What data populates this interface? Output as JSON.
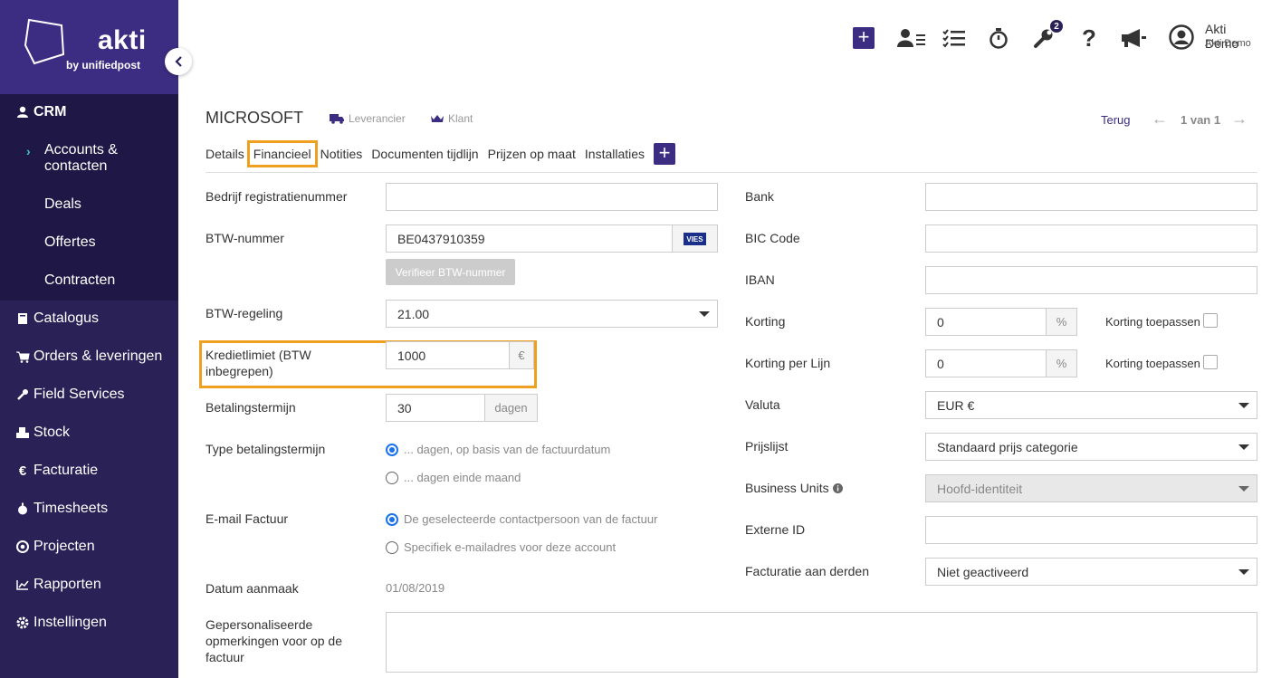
{
  "brand": {
    "name": "akti",
    "sub": "by unifiedpost"
  },
  "sidebar": {
    "crm": "CRM",
    "crm_items": [
      "Accounts &",
      "contacten",
      "Deals",
      "Offertes",
      "Contracten"
    ],
    "items": [
      "Catalogus",
      "Orders & leveringen",
      "Field Services",
      "Stock",
      "Facturatie",
      "Timesheets",
      "Projecten",
      "Rapporten",
      "Instellingen"
    ]
  },
  "topbar": {
    "badge_count": "2",
    "user_name": "Akti Demo",
    "user_company": "Akti Demo"
  },
  "header": {
    "company": "MICROSOFT",
    "tag_supplier": "Leverancier",
    "tag_client": "Klant",
    "back": "Terug",
    "pager": "1 van 1"
  },
  "tabs": [
    "Details",
    "Financieel",
    "Notities",
    "Documenten tijdlijn",
    "Prijzen op maat",
    "Installaties"
  ],
  "form_left": {
    "reg_label": "Bedrijf registratienummer",
    "btw_label": "BTW-nummer",
    "btw_value": "BE0437910359",
    "vies": "VIES",
    "verify_button": "Verifieer BTW-nummer",
    "regime_label": "BTW-regeling",
    "regime_value": "21.00",
    "credit_label_1": "Kredietlimiet (BTW",
    "credit_label_2": "inbegrepen)",
    "credit_value": "1000",
    "credit_unit": "€",
    "term_label": "Betalingstermijn",
    "term_value": "30",
    "term_unit": "dagen",
    "term_type_label": "Type betalingstermijn",
    "term_type_opt1": "... dagen, op basis van de factuurdatum",
    "term_type_opt2": "... dagen einde maand",
    "email_label": "E-mail Factuur",
    "email_opt1": "De geselecteerde contactpersoon van de factuur",
    "email_opt2": "Specifiek e-mailadres voor deze account",
    "created_label": "Datum aanmaak",
    "created_value": "01/08/2019",
    "remarks_label_1": "Gepersonaliseerde",
    "remarks_label_2": "opmerkingen voor op de",
    "remarks_label_3": "factuur"
  },
  "form_right": {
    "bank_label": "Bank",
    "bic_label": "BIC Code",
    "iban_label": "IBAN",
    "discount_label": "Korting",
    "discount_value": "0",
    "discount_unit": "%",
    "discount_apply": "Korting toepassen",
    "line_discount_label": "Korting per Lijn",
    "line_discount_value": "0",
    "line_discount_unit": "%",
    "line_discount_apply": "Korting toepassen",
    "currency_label": "Valuta",
    "currency_value": "EUR €",
    "pricelist_label": "Prijslijst",
    "pricelist_value": "Standaard prijs categorie",
    "bu_label": "Business Units",
    "bu_value": "Hoofd-identiteit",
    "ext_label": "Externe ID",
    "third_label": "Facturatie aan derden",
    "third_value": "Niet geactiveerd"
  }
}
